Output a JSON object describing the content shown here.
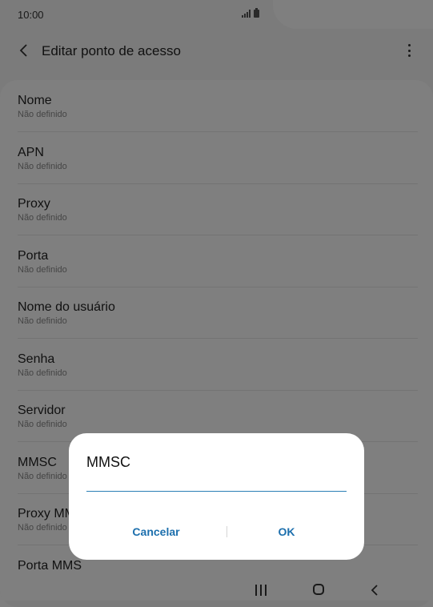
{
  "status_bar": {
    "time": "10:00"
  },
  "app_bar": {
    "title": "Editar ponto de acesso"
  },
  "settings": [
    {
      "label": "Nome",
      "value": "Não definido"
    },
    {
      "label": "APN",
      "value": "Não definido"
    },
    {
      "label": "Proxy",
      "value": "Não definido"
    },
    {
      "label": "Porta",
      "value": "Não definido"
    },
    {
      "label": "Nome do usuário",
      "value": "Não definido"
    },
    {
      "label": "Senha",
      "value": "Não definido"
    },
    {
      "label": "Servidor",
      "value": "Não definido"
    },
    {
      "label": "MMSC",
      "value": "Não definido"
    },
    {
      "label": "Proxy MMS",
      "value": "Não definido"
    },
    {
      "label": "Porta MMS",
      "value": ""
    }
  ],
  "dialog": {
    "title": "MMSC",
    "input_value": "",
    "cancel_label": "Cancelar",
    "ok_label": "OK"
  },
  "colors": {
    "accent": "#1c6fad",
    "underline": "#2a7fb5"
  }
}
